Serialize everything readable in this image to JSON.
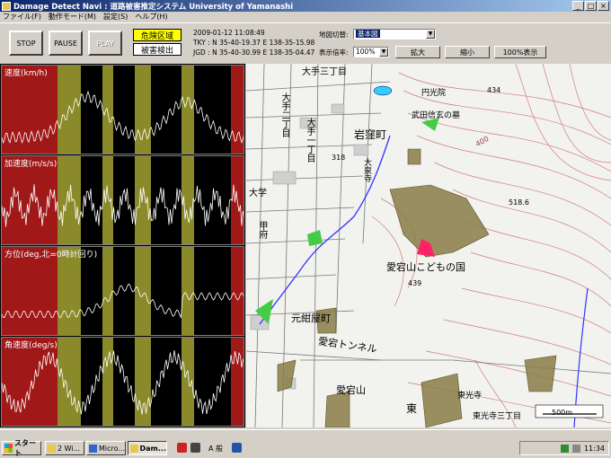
{
  "window": {
    "title": "Damage Detect Navi : 道路被害推定システム   University of Yamanashi",
    "controls": [
      "_",
      "□",
      "×"
    ]
  },
  "menu": [
    "ファイル(F)",
    "動作モード(M)",
    "設定(S)",
    "ヘルプ(H)"
  ],
  "toolbar": {
    "stop_label": "STOP",
    "pause_label": "PAUSE",
    "play_label": "PLAY",
    "danger_zone_label": "危険区域",
    "damage_detect_label": "被害検出",
    "timestamp": "2009-01-12 11:08:49",
    "tky_coords": "TKY : N 35-40-19.37  E 138-35-15.98",
    "jgd_coords": "JGD : N 35-40-30.99  E 138-35-04.47",
    "map_switch_label": "地図切替:",
    "map_switch_value": "基本図",
    "zoom_ratio_label": "表示倍率:",
    "zoom_ratio_value": "100%",
    "zoom_in_label": "拡大",
    "zoom_out_label": "縮小",
    "zoom_reset_label": "100%表示"
  },
  "graphs": [
    {
      "label": "速度(km/h)",
      "color": "#ffffff"
    },
    {
      "label": "加速度(m/s/s)",
      "color": "#ffffff"
    },
    {
      "label": "方位(deg,北=0時計回り)",
      "color": "#ffffff"
    },
    {
      "label": "角速度(deg/s)",
      "color": "#ffffff"
    }
  ],
  "colors": {
    "zone_danger": "#a01818",
    "zone_caution": "#8a8a2a",
    "zone_normal": "#000000",
    "trace": "#ffffff",
    "hazard_area": "#8a7d45",
    "park": "#44cc44",
    "current_position": "#ff2266"
  },
  "map": {
    "labels": [
      "大手三丁目",
      "大手二丁目",
      "大手一丁目",
      "円光院",
      "武田信玄の墓",
      "岩窪町",
      "大泉寺",
      "愛宕山こどもの国",
      "元紺屋町",
      "愛宕トンネル",
      "愛宕山",
      "東光寺",
      "東光寺三丁目",
      "大学",
      "甲府",
      "東",
      "434",
      "318",
      "518.6",
      "439",
      "400"
    ],
    "scale_label": "500m"
  },
  "taskbar": {
    "start_label": "スタート",
    "tasks": [
      "2 Wi...",
      "Micro...",
      "Dam..."
    ],
    "ime_label": "A 般",
    "clock": "11:34"
  }
}
